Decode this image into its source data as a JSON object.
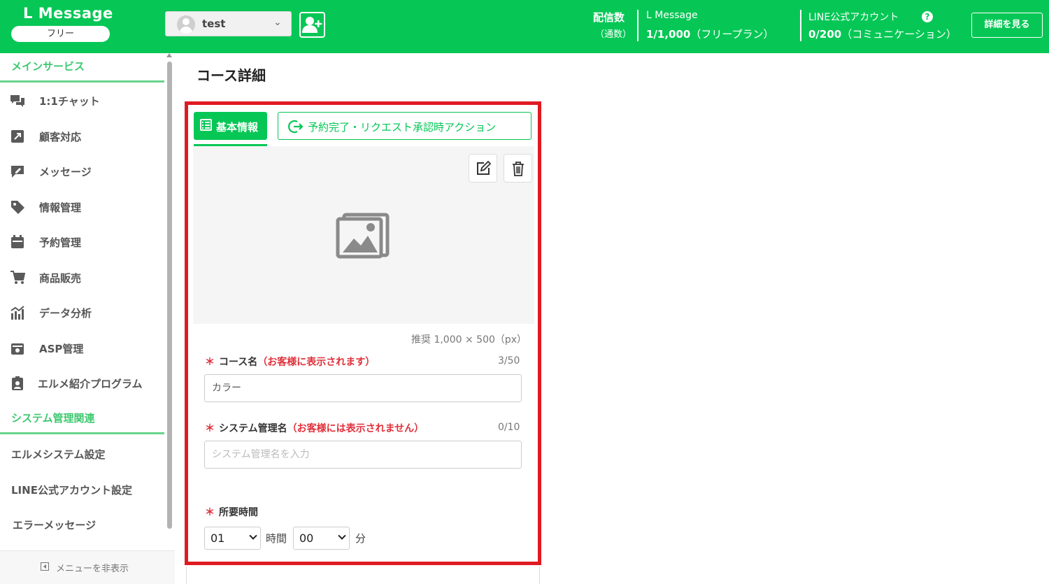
{
  "header": {
    "logo": "L Message",
    "plan_badge": "フリー",
    "account_name": "test",
    "stat_title": "配信数",
    "stat_sub": "（通数）",
    "lmessage": {
      "title": "L Message",
      "count": "1/1,000",
      "plan": "（フリープラン）"
    },
    "official_account": {
      "title": "LINE公式アカウント",
      "count": "0/200",
      "plan": "（コミュニケーション）"
    },
    "details_button": "詳細を見る",
    "brand_color": "#06c755"
  },
  "sidebar": {
    "section_main": "メインサービス",
    "items": [
      {
        "label": "1:1チャット",
        "icon": "chat-icon"
      },
      {
        "label": "顧客対応",
        "icon": "arrow-up-right-icon"
      },
      {
        "label": "メッセージ",
        "icon": "message-edit-icon"
      },
      {
        "label": "情報管理",
        "icon": "tag-icon"
      },
      {
        "label": "予約管理",
        "icon": "calendar-icon"
      },
      {
        "label": "商品販売",
        "icon": "cart-icon"
      },
      {
        "label": "データ分析",
        "icon": "chart-icon"
      },
      {
        "label": "ASP管理",
        "icon": "asp-icon"
      },
      {
        "label": "エルメ紹介プログラム",
        "icon": "clipboard-user-icon"
      }
    ],
    "section_system": "システム管理関連",
    "system_items": [
      {
        "label": "エルメシステム設定"
      },
      {
        "label": "LINE公式アカウント設定"
      },
      {
        "label": "エラーメッセージ"
      }
    ],
    "hide_menu": "メニューを非表示"
  },
  "main": {
    "page_title": "コース詳細",
    "tabs": [
      {
        "label": "基本情報",
        "active": true
      },
      {
        "label": "予約完了・リクエスト承認時アクション",
        "active": false
      }
    ],
    "recommended_size": "推奨 1,000 × 500（px）",
    "course_name": {
      "label": "コース名",
      "note": "（お客様に表示されます）",
      "counter": "3/50",
      "value": "カラー"
    },
    "system_name": {
      "label": "システム管理名",
      "note": "（お客様には表示されません）",
      "counter": "0/10",
      "placeholder": "システム管理名を入力"
    },
    "duration": {
      "label": "所要時間",
      "hours": "01",
      "hours_unit": "時間",
      "minutes": "00",
      "minutes_unit": "分"
    }
  }
}
